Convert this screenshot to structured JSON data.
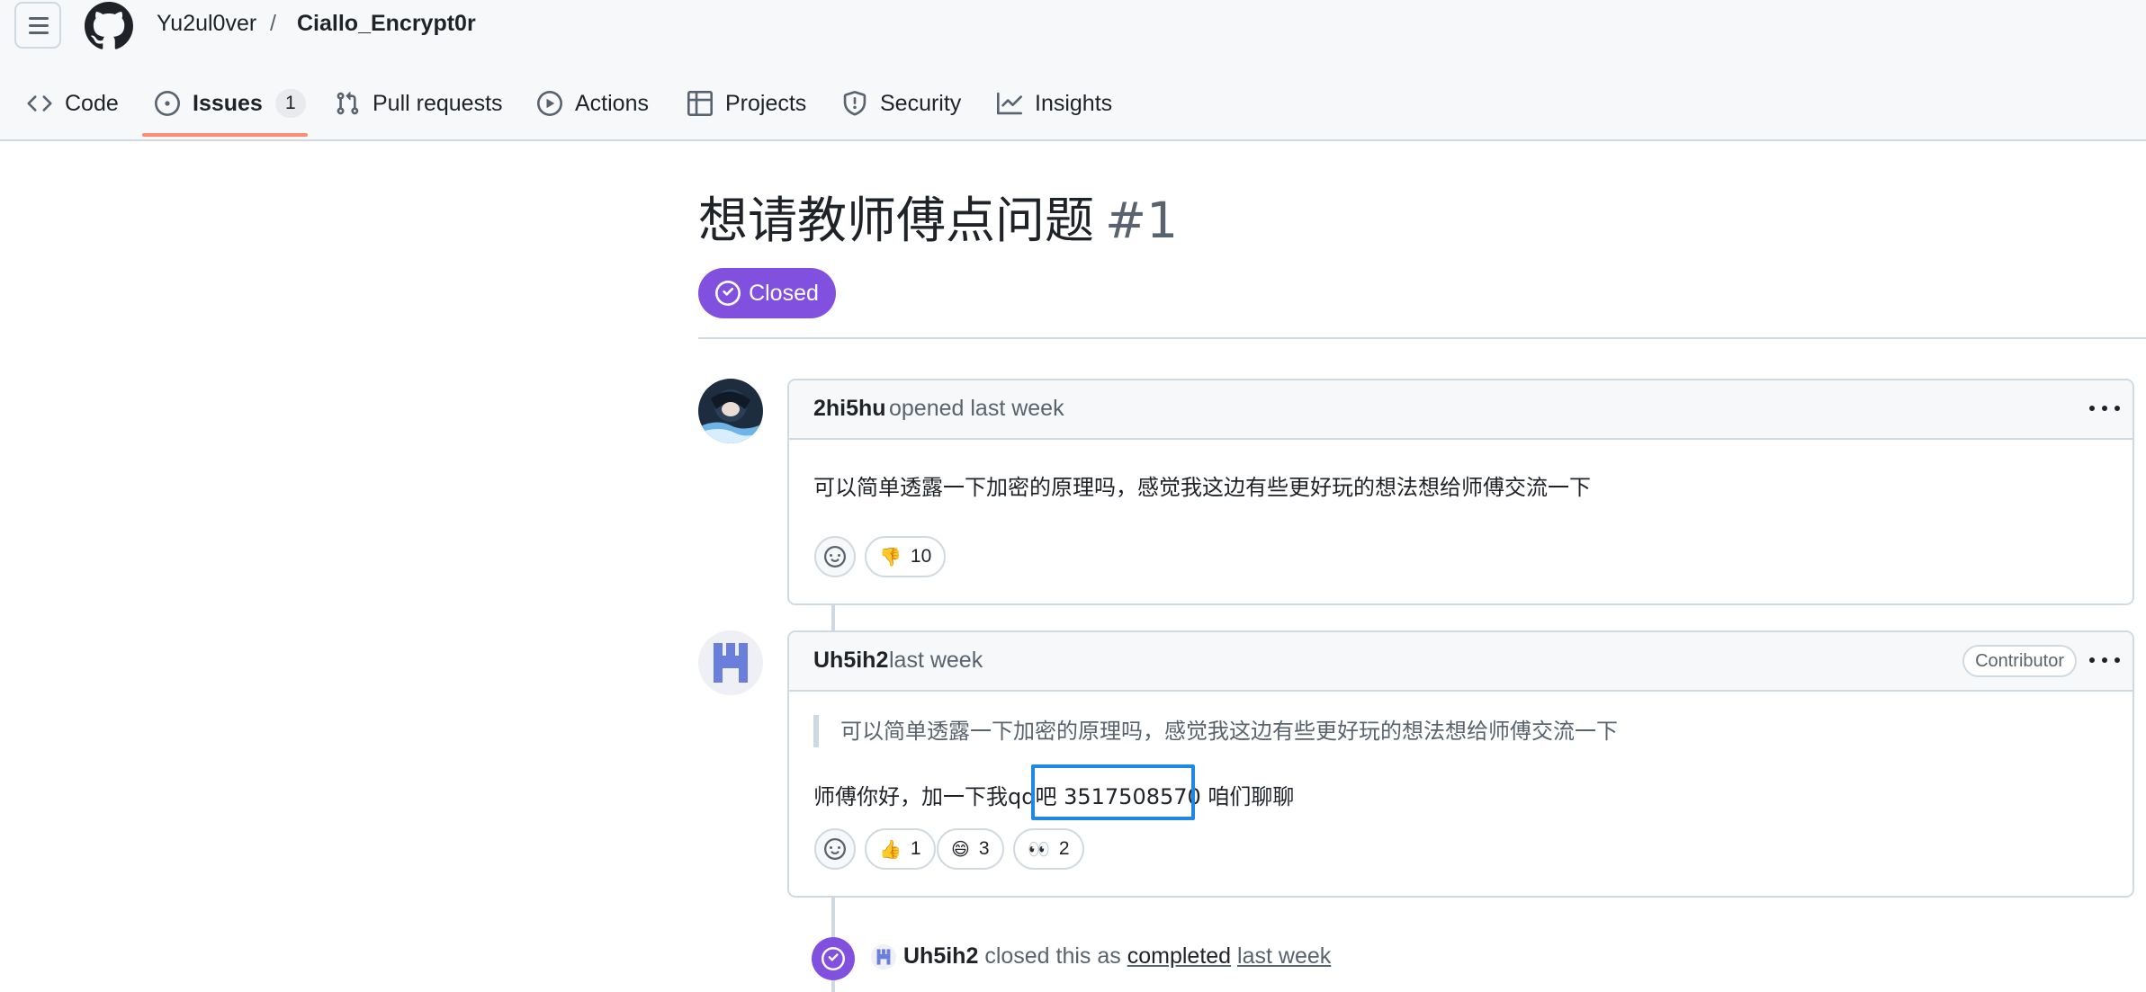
{
  "header": {
    "owner": "Yu2ul0ver",
    "separator": "/",
    "repo": "Ciallo_Encrypt0r"
  },
  "tabs": [
    {
      "label": "Code",
      "icon": "code-icon"
    },
    {
      "label": "Issues",
      "icon": "issue-opened-icon",
      "count": "1",
      "selected": true
    },
    {
      "label": "Pull requests",
      "icon": "git-pull-request-icon"
    },
    {
      "label": "Actions",
      "icon": "play-icon"
    },
    {
      "label": "Projects",
      "icon": "table-icon"
    },
    {
      "label": "Security",
      "icon": "shield-icon"
    },
    {
      "label": "Insights",
      "icon": "graph-icon"
    }
  ],
  "issue": {
    "title": "想请教师傅点问题",
    "number": "#1",
    "state": "Closed"
  },
  "comments": [
    {
      "author": "2hi5hu",
      "meta": "opened last week",
      "body": "可以简单透露一下加密的原理吗，感觉我这边有些更好玩的想法想给师傅交流一下",
      "reactions": [
        {
          "emoji": "👎",
          "count": "10"
        }
      ]
    },
    {
      "author": "Uh5ih2",
      "meta": "last week",
      "badge": "Contributor",
      "quote": "可以简单透露一下加密的原理吗，感觉我这边有些更好玩的想法想给师傅交流一下",
      "body": "师傅你好，加一下我qq吧 3517508570 咱们聊聊",
      "reactions": [
        {
          "emoji": "👍",
          "count": "1"
        },
        {
          "emoji": "😄",
          "count": "3"
        },
        {
          "emoji": "👀",
          "count": "2"
        }
      ]
    }
  ],
  "closed_event": {
    "actor": "Uh5ih2",
    "action": "closed this as",
    "reason": "completed",
    "time": "last week"
  },
  "colors": {
    "closed_purple": "#8250df",
    "tab_underline": "#fd8c73",
    "highlight": "#1e88e5"
  }
}
